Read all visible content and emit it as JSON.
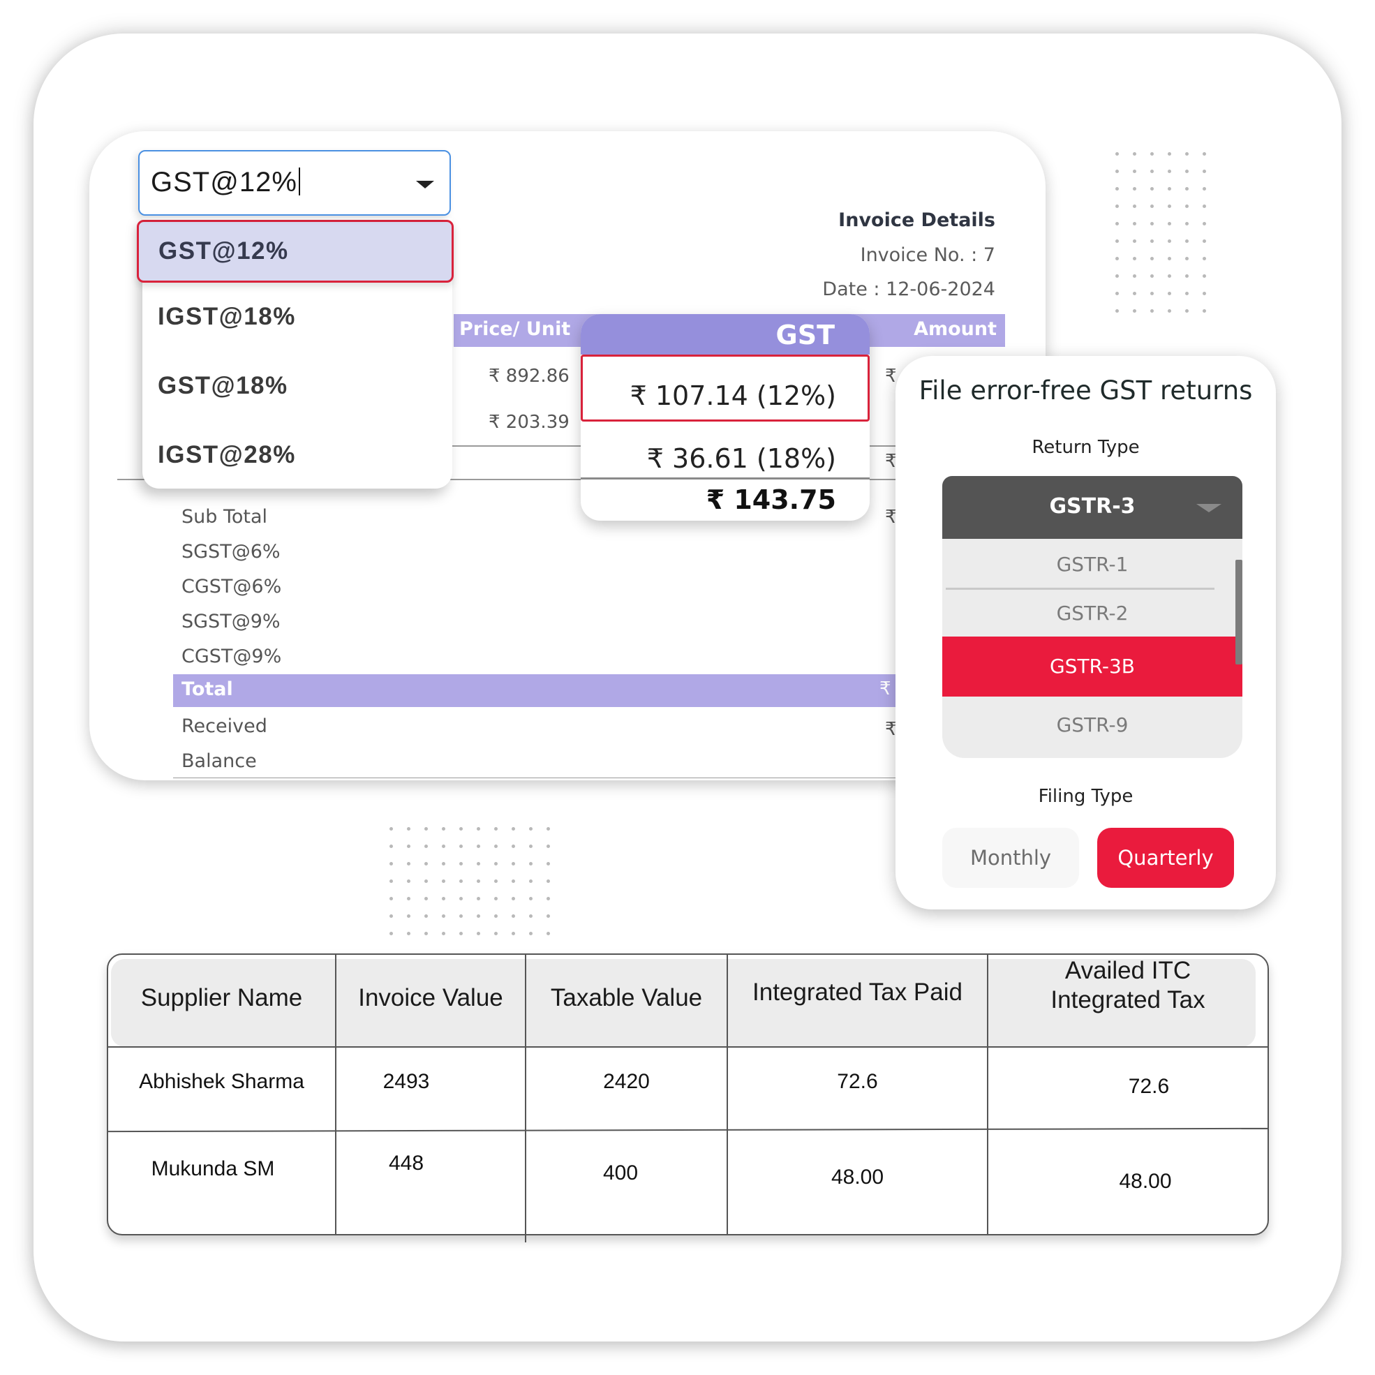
{
  "invoice": {
    "details_title": "Invoice Details",
    "invoice_no": "Invoice No. : 7",
    "date": "Date : 12-06-2024",
    "columns": {
      "price_per_unit": "Price/ Unit",
      "gst": "GST",
      "amount": "Amount"
    },
    "rows": [
      {
        "price": "₹ 892.86",
        "gst": "₹ 107.14 (12%)",
        "amount_prefix": "₹"
      },
      {
        "price": "₹ 203.39",
        "gst": "₹ 36.61 (18%)",
        "amount_prefix": "₹"
      }
    ],
    "gst_total": "₹ 143.75",
    "summary": {
      "sub_total": "Sub Total",
      "sgst6": "SGST@6%",
      "cgst6": "CGST@6%",
      "sgst9": "SGST@9%",
      "cgst9": "CGST@9%",
      "total": "Total",
      "received": "Received",
      "balance": "Balance",
      "rupee": "₹"
    }
  },
  "tax_select": {
    "value": "GST@12%",
    "options": [
      "GST@12%",
      "IGST@18%",
      "GST@18%",
      "IGST@28%"
    ],
    "selected_index": 0
  },
  "gst_returns": {
    "title": "File error-free GST returns",
    "return_type_label": "Return Type",
    "return_type_value": "GSTR-3",
    "return_type_options": [
      "GSTR-1",
      "GSTR-2",
      "GSTR-3B",
      "GSTR-9"
    ],
    "highlighted_option": "GSTR-3B",
    "filing_type_label": "Filing Type",
    "filing_options": [
      "Monthly",
      "Quarterly"
    ],
    "selected_filing": "Quarterly"
  },
  "itc_table": {
    "headers": [
      "Supplier Name",
      "Invoice Value",
      "Taxable Value",
      "Integrated Tax Paid",
      "Availed ITC Integrated Tax"
    ],
    "header_last_line1": "Availed ITC",
    "header_last_line2": "Integrated Tax",
    "rows": [
      [
        "Abhishek Sharma",
        "2493",
        "2420",
        "72.6",
        "72.6"
      ],
      [
        "Mukunda SM",
        "448",
        "400",
        "48.00",
        "48.00"
      ]
    ]
  },
  "colors": {
    "accent_red": "#ea1b3d",
    "purple_header": "#b0a8e6",
    "gst_header": "#958fdc",
    "dark_select": "#545454"
  }
}
